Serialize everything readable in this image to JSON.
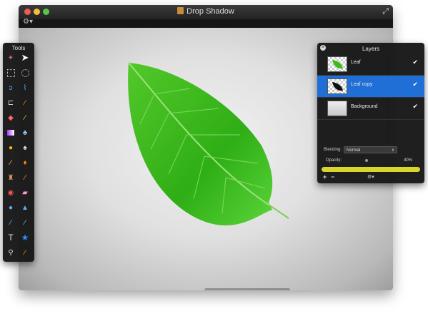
{
  "window": {
    "title": "Drop Shadow"
  },
  "tools": {
    "title": "Tools"
  },
  "layers": {
    "title": "Layers",
    "close_icon": "close-icon",
    "items": [
      {
        "name": "Leaf",
        "visible": true,
        "selected": false
      },
      {
        "name": "Leaf copy",
        "visible": true,
        "selected": true
      },
      {
        "name": "Background",
        "visible": true,
        "selected": false
      }
    ],
    "blending_label": "Blending:",
    "blending_value": "Normal",
    "opacity_label": "Opacity:",
    "opacity_value": "40%",
    "opacity_fraction": 1.0
  },
  "colors": {
    "selection_blue": "#1f6fd6",
    "leaf_green": "#3dbb18",
    "opacity_yellow": "#d9d52d"
  }
}
